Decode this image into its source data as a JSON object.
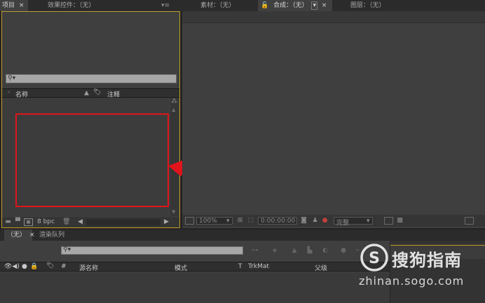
{
  "project_panel": {
    "tab_label": "项目",
    "tab_close": "×",
    "effects_tab_label": "效果控件：（无）",
    "search_placeholder": "",
    "col_name": "名称",
    "col_comment": "注释",
    "bpc_label": "8 bpc"
  },
  "viewer": {
    "footage_tab": "素材：（无）",
    "comp_tab": "合成：（无）",
    "comp_tab_dropdown": "▾",
    "comp_tab_close": "×",
    "layer_tab": "图层：（无）",
    "zoom_value": "100%",
    "timecode_value": "0:00:00:00",
    "resolution_value": "完整"
  },
  "timeline": {
    "comp_tab_label": "（无）",
    "comp_tab_close": "×",
    "render_queue_tab": "渲染队列",
    "search_placeholder": "",
    "cols": {
      "hash": "#",
      "source_name": "源名称",
      "mode": "模式",
      "t": "T",
      "trkmat": "TrkMat",
      "parent": "父级"
    }
  },
  "watermark": {
    "brand_text": "搜狗指南",
    "url": "zhinan.sogo.com"
  },
  "colors": {
    "annotation_red": "#e0141b",
    "panel_bg": "#3f3f3f",
    "focus_border": "#c29c2c"
  }
}
